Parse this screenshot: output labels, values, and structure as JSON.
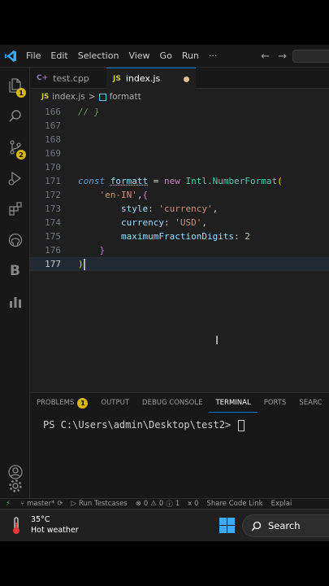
{
  "titlebar": {
    "menu": [
      "File",
      "Edit",
      "Selection",
      "View",
      "Go",
      "Run",
      "···"
    ],
    "back_icon": "←",
    "forward_icon": "→"
  },
  "activity_bar": {
    "explorer_badge": "1",
    "source_control_badge": "2",
    "blackbox_label": "B"
  },
  "tabs": [
    {
      "label": "test.cpp",
      "icon": "C+",
      "active": false
    },
    {
      "label": "index.js",
      "icon": "JS",
      "active": true,
      "dirty": true
    }
  ],
  "breadcrumb": {
    "file_icon": "JS",
    "file": "index.js",
    "separator": ">",
    "symbol": "formatt"
  },
  "editor": {
    "lines": [
      {
        "n": "166",
        "text": "// }"
      },
      {
        "n": "167",
        "text": ""
      },
      {
        "n": "168",
        "text": ""
      },
      {
        "n": "169",
        "text": ""
      },
      {
        "n": "170",
        "text": ""
      },
      {
        "n": "171",
        "t_const": "const",
        "t_var": "formatt",
        "t_eq": " = ",
        "t_new": "new",
        "t_cls": "Intl.NumberFormat",
        "t_open": "("
      },
      {
        "n": "172",
        "t_str": "'en-IN'",
        "t_mid": ",",
        "t_brace": "{"
      },
      {
        "n": "173",
        "t_prop": "style",
        "t_colon": ": ",
        "t_val": "'currency'",
        "t_end": ","
      },
      {
        "n": "174",
        "t_prop": "currency",
        "t_colon": ": ",
        "t_val": "'USD'",
        "t_end": ","
      },
      {
        "n": "175",
        "t_prop": "maximumFractionDigits",
        "t_colon": ": ",
        "t_val": "2",
        "t_end": ""
      },
      {
        "n": "176",
        "t_brace": "}"
      },
      {
        "n": "177",
        "t_close": ")"
      }
    ]
  },
  "panel": {
    "tabs": [
      {
        "label": "PROBLEMS",
        "badge": "1"
      },
      {
        "label": "OUTPUT"
      },
      {
        "label": "DEBUG CONSOLE"
      },
      {
        "label": "TERMINAL",
        "active": true
      },
      {
        "label": "PORTS"
      },
      {
        "label": "SEARC"
      }
    ],
    "terminal_prompt": "PS C:\\Users\\admin\\Desktop\\test2>"
  },
  "statusbar": {
    "branch": "master*",
    "run_testcases": "Run Testcases",
    "errors": "0",
    "warnings": "0",
    "info": "1",
    "ports": "0",
    "share_code": "Share Code Link",
    "explain": "Explai"
  },
  "taskbar": {
    "temperature": "35°C",
    "weather": "Hot weather",
    "search": "Search"
  },
  "colors": {
    "accent": "#0078d4",
    "badge": "#d7b515",
    "modified_dot": "#e2c08d"
  }
}
